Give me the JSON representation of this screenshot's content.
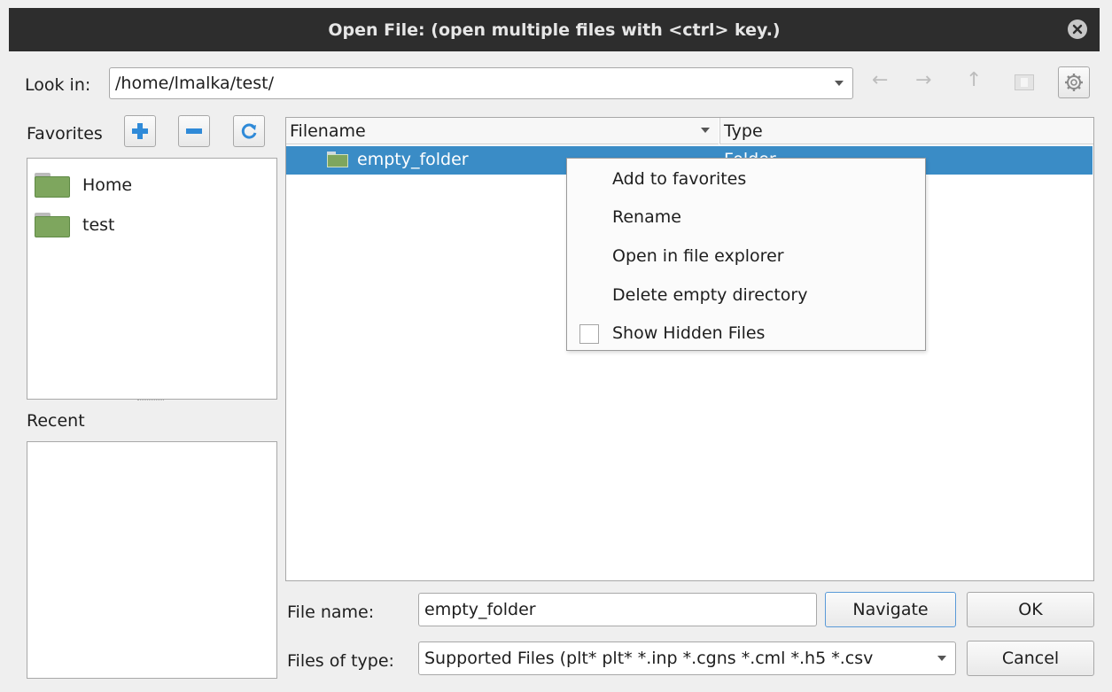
{
  "window": {
    "title": "Open File:  (open multiple files with <ctrl> key.)"
  },
  "look_in": {
    "label": "Look in:",
    "path": "/home/lmalka/test/"
  },
  "nav": {
    "back": "←",
    "forward": "→",
    "up": "↑"
  },
  "favorites": {
    "label": "Favorites",
    "items": [
      {
        "label": "Home"
      },
      {
        "label": "test"
      }
    ]
  },
  "recent": {
    "label": "Recent"
  },
  "file_list": {
    "columns": [
      {
        "label": "Filename"
      },
      {
        "label": "Type"
      }
    ],
    "rows": [
      {
        "name": "empty_folder",
        "type": "Folder"
      }
    ]
  },
  "context_menu": {
    "items": [
      {
        "label": "Add to favorites"
      },
      {
        "label": "Rename"
      },
      {
        "label": "Open in file explorer"
      },
      {
        "label": "Delete empty directory"
      }
    ],
    "checkbox": {
      "label": "Show Hidden Files",
      "checked": false
    }
  },
  "file_name": {
    "label": "File name:",
    "value": "empty_folder"
  },
  "file_type": {
    "label": "Files of type:",
    "value": "Supported Files (plt* plt* *.inp *.cgns *.cml *.h5 *.csv"
  },
  "buttons": {
    "navigate": "Navigate",
    "ok": "OK",
    "cancel": "Cancel"
  },
  "colors": {
    "selection": "#3a8cc6",
    "folder": "#7ea65e",
    "accent": "#2f8ad8"
  }
}
